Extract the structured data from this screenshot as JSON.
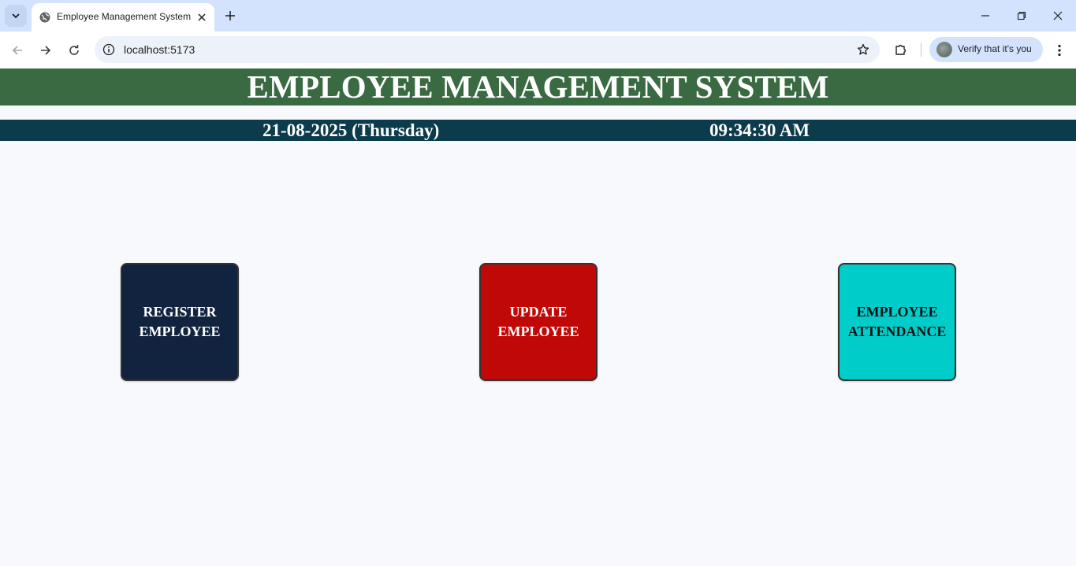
{
  "browser": {
    "tab_title": "Employee Management System",
    "url": "localhost:5173",
    "profile_label": "Verify that it's you"
  },
  "header": {
    "title": "EMPLOYEE MANAGEMENT SYSTEM"
  },
  "info_bar": {
    "date": "21-08-2025 (Thursday)",
    "time": "09:34:30 AM"
  },
  "cards": [
    {
      "line1": "REGISTER",
      "line2": "EMPLOYEE",
      "color": "#12233f",
      "text_color": "#ffffff"
    },
    {
      "line1": "UPDATE",
      "line2": "EMPLOYEE",
      "color": "#c00806",
      "text_color": "#ffffff"
    },
    {
      "line1": "EMPLOYEE",
      "line2": "ATTENDANCE",
      "color": "#00cdca",
      "text_color": "#111111"
    }
  ],
  "colors": {
    "header_bg": "#3a6a42",
    "info_bar_bg": "#0c3c4c",
    "page_bg": "#f8f9fc"
  }
}
